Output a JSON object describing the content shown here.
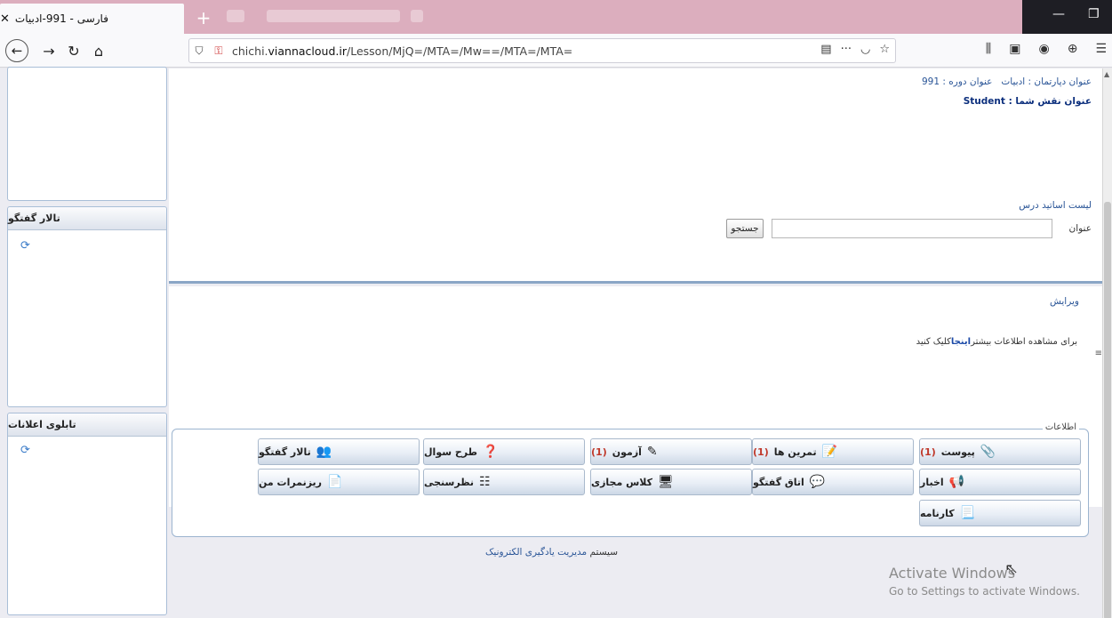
{
  "browser": {
    "tab_title": "فارسی - 991-ادبیات",
    "tab_close": "✕",
    "new_tab": "+",
    "url_host_prefix": "chichi.",
    "url_host": "viannacloud.ir",
    "url_path": "/Lesson/MjQ=/MTA=/Mw==/MTA=/MTA=",
    "icons": [
      "back-icon",
      "forward-icon",
      "reload-icon",
      "home-icon",
      "shield-icon",
      "insecure-lock-icon",
      "reader-icon",
      "more-icon",
      "pocket-icon",
      "bookmark-star-icon",
      "library-icon",
      "sidebar-icon",
      "account-icon",
      "extension-icon",
      "menu-icon"
    ]
  },
  "left": {
    "forum_title": "تالار گفتگو",
    "board_title": "تابلوی اعلانات"
  },
  "header": {
    "department_label": "عنوان دپارتمان : ادبیات",
    "course_label": "عنوان دوره : 991",
    "role_label": "عنوان نقش شما :",
    "role_value": "Student"
  },
  "teachers": {
    "title": "لیست اساتید درس",
    "search_label": "عنوان",
    "search_value": "",
    "search_button": "جستجو"
  },
  "details": {
    "edit_link": "ویرایش",
    "more_prefix": "برای مشاهده اطلاعات بیشتر",
    "more_link": "اینجا",
    "more_suffix": "کلیک کنید"
  },
  "menu": {
    "legend": "اطلاعات",
    "buttons": [
      {
        "label": "پیوست",
        "count": "(1)"
      },
      {
        "label": "تمرین ها",
        "count": "(1)"
      },
      {
        "label": "آزمون",
        "count": "(1)"
      },
      {
        "label": "طرح سوال",
        "count": ""
      },
      {
        "label": "تالار گفتگو",
        "count": ""
      },
      {
        "label": "اخبار",
        "count": ""
      },
      {
        "label": "اتاق گفتگو",
        "count": ""
      },
      {
        "label": "کلاس مجازی",
        "count": ""
      },
      {
        "label": "نظرسنجی",
        "count": ""
      },
      {
        "label": "ریزنمرات من",
        "count": ""
      },
      {
        "label": "کارنامه",
        "count": ""
      }
    ]
  },
  "footer": {
    "prefix": "سیستم",
    "name": "مدیریت یادگیری الکترونیک"
  },
  "os": {
    "activate_title": "Activate Windows",
    "activate_sub": "Go to Settings to activate Windows."
  },
  "colors": {
    "tabbar": "#dcaebe",
    "link": "#2a5597",
    "count": "#c0392b",
    "panel_border": "#8aa6c6"
  }
}
